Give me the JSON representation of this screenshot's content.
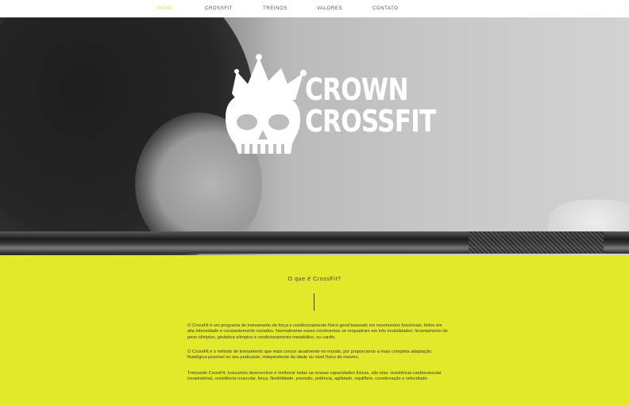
{
  "nav": {
    "items": [
      {
        "label": "HOME",
        "active": true
      },
      {
        "label": "CROSSFIT",
        "active": false
      },
      {
        "label": "TREINOS",
        "active": false
      },
      {
        "label": "VALORES",
        "active": false
      },
      {
        "label": "CONTATO",
        "active": false
      }
    ]
  },
  "hero": {
    "brand_line1": "CROWN",
    "brand_line2": "CROSSFIT",
    "logo_icon": "crowned-skull-icon"
  },
  "content": {
    "title": "O que é CrossFit?",
    "paragraphs": [
      "O CrossFit é um programa de treinamento de força e condicionamento físico geral baseado em movimentos funcionais, feitos em alta intensidade e constantemente variados. Normalmente esses movimentos se enquadram em três modalidades: levantamento de peso olímpico, ginástica olímpica e condicionamento metabólico, ou cardio.",
      "O CrossFit é o método de treinamento que mais cresce atualmente no mundo, por proporcionar a mais completa adaptação fisiológica possível no seu praticante, independente da idade ou nível físico do mesmo.",
      "Treinando CrossFit, buscamos desenvolver e melhorar todas as nossas capacidades físicas, são elas: resistência cardiovascular (respiratória), resistência muscular, força, flexibilidade, precisão, potência, agilidade, equilíbrio, coordenação e velocidade."
    ]
  },
  "colors": {
    "accent": "#e2e82a",
    "text": "#3a3a3a",
    "nav_bg": "#ffffff"
  }
}
